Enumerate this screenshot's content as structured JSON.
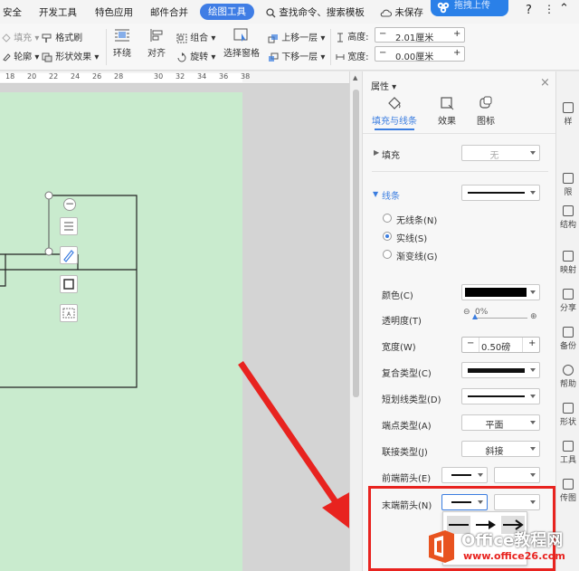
{
  "menubar": {
    "items": [
      "安全",
      "开发工具",
      "特色应用",
      "邮件合并"
    ],
    "active_tab": "绘图工具",
    "search": "查找命令、搜索模板",
    "unsaved": "未保存",
    "upload": "拖拽上传",
    "help": "?"
  },
  "ribbon": {
    "fill": "填充",
    "format_brush": "格式刷",
    "outline": "轮廓",
    "shape_effect": "形状效果",
    "wrap": "环绕",
    "align": "对齐",
    "group": "组合",
    "rotate": "旋转",
    "selection_pane": "选择窗格",
    "bring_forward": "上移一层",
    "send_backward": "下移一层",
    "height_label": "高度:",
    "height_value": "2.01厘米",
    "width_label": "宽度:",
    "width_value": "0.00厘米"
  },
  "ruler": {
    "ticks": [
      "18",
      "20",
      "22",
      "24",
      "26",
      "28",
      "30",
      "32",
      "34",
      "36",
      "38"
    ]
  },
  "panel": {
    "title": "属性",
    "tabs": [
      "填充与线条",
      "效果",
      "图标"
    ],
    "fill_label": "填充",
    "fill_value": "无",
    "line_label": "线条",
    "no_line": "无线条(N)",
    "solid_line": "实线(S)",
    "gradient_line": "渐变线(G)",
    "color_label": "颜色(C)",
    "transparency_label": "透明度(T)",
    "transparency_value": "0%",
    "width_label": "宽度(W)",
    "width_value": "0.50磅",
    "compound_label": "复合类型(C)",
    "dash_label": "短划线类型(D)",
    "cap_label": "端点类型(A)",
    "cap_value": "平面",
    "join_label": "联接类型(J)",
    "join_value": "斜接",
    "begin_arrow_label": "前端箭头(E)",
    "end_arrow_label": "末端箭头(N)"
  },
  "rail": {
    "items": [
      "样",
      "限",
      "结构",
      "映射",
      "分享",
      "备份",
      "帮助",
      "形状",
      "工具",
      "传图"
    ]
  },
  "watermark": {
    "brand": "Office教程网",
    "url": "www.office26.com"
  },
  "colors": {
    "accent": "#3f7de5",
    "page_bg": "#c9ebce",
    "highlight_red": "#e8231f",
    "line_color": "#000000"
  }
}
